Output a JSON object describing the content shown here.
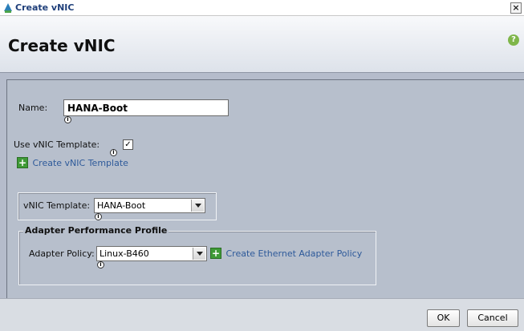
{
  "window": {
    "title": "Create vNIC",
    "close_glyph": "×"
  },
  "header": {
    "title": "Create vNIC",
    "help_icon": "help-icon"
  },
  "form": {
    "name_label": "Name:",
    "name_value": "HANA-Boot",
    "use_template_label": "Use vNIC Template:",
    "use_template_checked": true,
    "create_template_link": "Create vNIC Template",
    "template_label": "vNIC Template:",
    "template_value": "HANA-Boot",
    "adapter_section_title": "Adapter Performance Profile",
    "adapter_policy_label": "Adapter Policy:",
    "adapter_policy_value": "Linux-B460",
    "create_adapter_policy_link": "Create Ethernet Adapter Policy"
  },
  "footer": {
    "ok_label": "OK",
    "cancel_label": "Cancel"
  },
  "colors": {
    "panel_bg": "#b7bfcc",
    "link": "#2e5a9a",
    "plus_icon": "#3f9a37",
    "help_icon": "#7fb64a"
  }
}
